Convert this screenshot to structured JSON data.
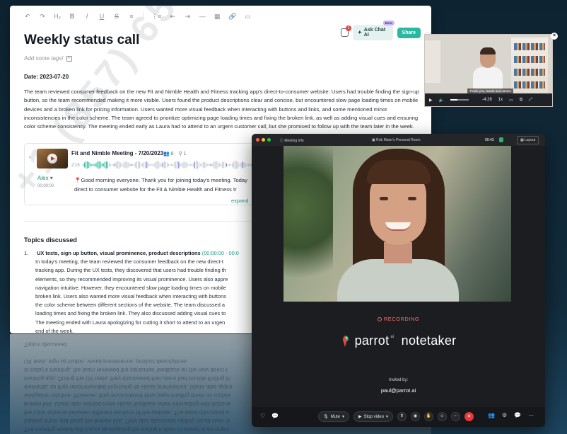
{
  "toolbar": {
    "items": [
      "↶",
      "↷",
      "H₂",
      "B",
      "I",
      "U",
      "S",
      "≡",
      "⋮≡",
      "⇤",
      "⇥",
      "—",
      "▦",
      "🔗",
      "▭"
    ]
  },
  "header": {
    "notification_count": "1",
    "ask_chat_label": "Ask Chat AI",
    "ask_chat_badge": "Beta",
    "share_label": "Share",
    "more_label": "⋯"
  },
  "doc": {
    "title": "Weekly status call",
    "tags_placeholder": "Add some tags!",
    "date": "Date: 2023-07-20",
    "summary": "The team reviewed consumer feedback on the new Fit and Nimble Health and Fitness tracking app's direct-to-consumer website. Users had trouble finding the sign-up button, so the team recommended making it more visible. Users found the product descriptions clear and concise, but encountered slow page loading times on mobile devices and a broken link for pricing information. Users wanted more visual feedback when interacting with buttons and links, and some mentioned minor inconsistencies in the color scheme. The team agreed to prioritize optimizing page loading times and fixing the broken link, as well as adding visual cues and ensuring color scheme consistency. The meeting ended early as Laura had to attend to an urgent customer call, but she promised to follow up with the team later in the week."
  },
  "meeting_card": {
    "title": "Fit and Nimble Meeting - 7/20/2023",
    "participants": "8",
    "highlights": "1",
    "elapsed": "2:15",
    "speaker": "Alex",
    "speaker_time": "00:00:00",
    "line1": "Good morning everyone. Thank you for joining today's meeting. Today",
    "line2": "direct to consumer website for the Fit & Nimble Health and Fitness tr",
    "expand_label": "expand"
  },
  "topics": {
    "heading": "Topics discussed",
    "items": [
      {
        "num": "1.",
        "head": "UX tests, sign up button, visual prominence, product descriptions",
        "link": "(00:00:00 - 00:0",
        "lines": [
          "In today's meeting, the team reviewed the consumer feedback on the new direct-t",
          "tracking app. During the UX tests, they discovered that users had trouble finding th",
          "elements, so they recommended improving its visual prominence. Users also appre",
          "navigation intuitive. However, they encountered slow page loading times on mobile",
          "broken link. Users also wanted more visual feedback when interacting with buttons",
          "the color scheme between different sections of the website. The team discussed a",
          "loading times and fixing the broken link. They also discussed adding visual cues to",
          "The meeting ended with Laura apologizing for cutting it short to attend to an urgen",
          "end of the week."
        ]
      }
    ]
  },
  "watermark": "+1 (857) 657 0369",
  "mini_video": {
    "caption": "Thank you, Sarah and James",
    "time": "-4:26",
    "speed": "1x"
  },
  "meeting": {
    "info_label": "Meeting info",
    "room": "Rob Maier's Personal Room",
    "timer": "00:43",
    "layout_label": "Layout",
    "recording_label": "RECORDING",
    "brand_name": "parrot",
    "brand_sup": "ai",
    "brand_suffix": "notetaker",
    "invited_label": "Invited by:",
    "invited_email": "paul@parrot.ai",
    "mute_label": "Mute",
    "video_label": "Stop video"
  },
  "colors": {
    "accent": "#2bb8a1",
    "recording": "#ff6b5e",
    "end_call": "#e53935"
  }
}
